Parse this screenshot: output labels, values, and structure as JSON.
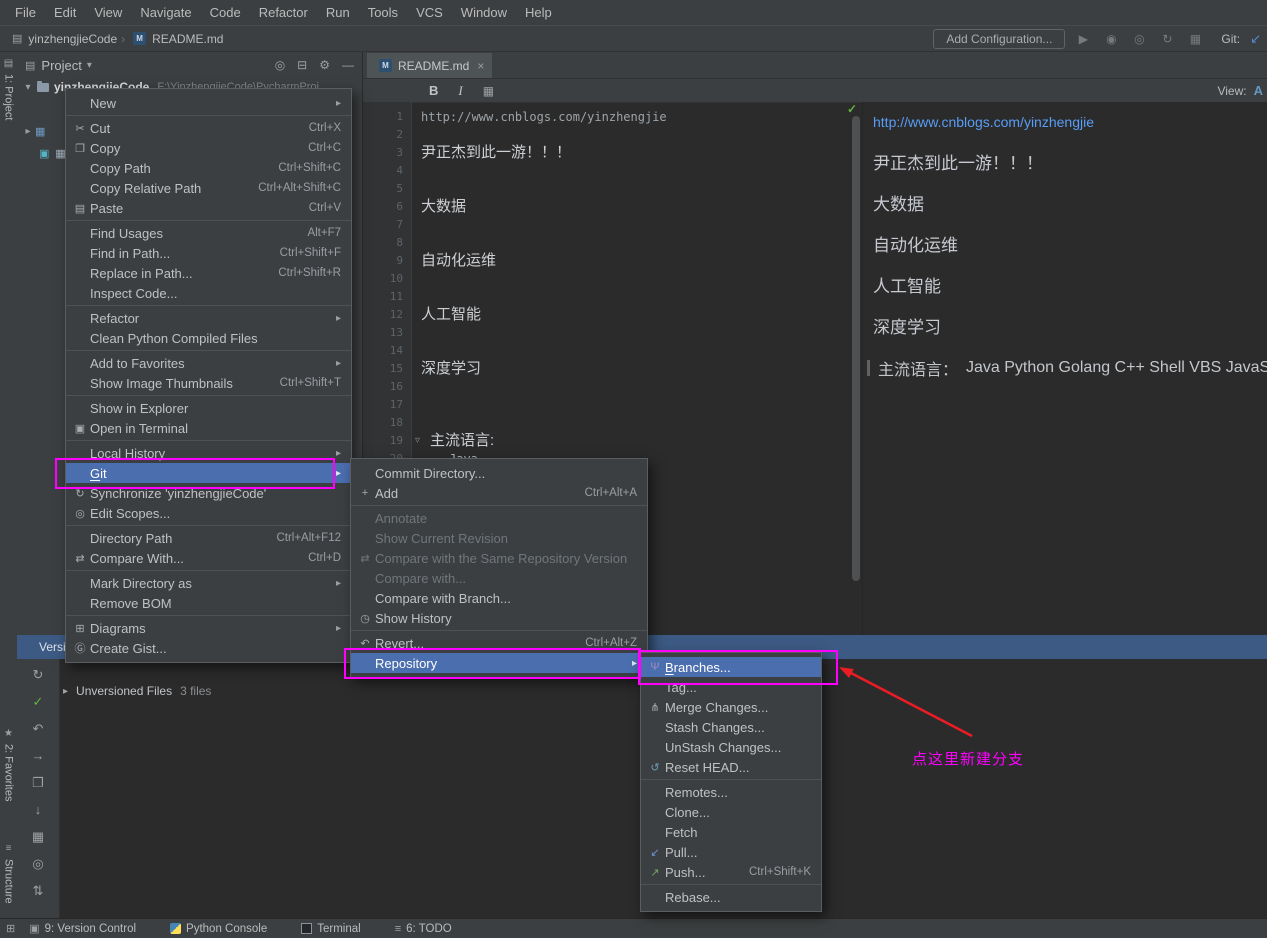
{
  "menubar": [
    "File",
    "Edit",
    "View",
    "Navigate",
    "Code",
    "Refactor",
    "Run",
    "Tools",
    "VCS",
    "Window",
    "Help"
  ],
  "navbar": {
    "project": "yinzhengjieCode",
    "file": "README.md",
    "add_configuration": "Add Configuration...",
    "actions": [
      "run",
      "debug",
      "coverage",
      "profiler",
      "stop"
    ],
    "git_label": "Git:"
  },
  "left_stripe": [
    {
      "label": "1: Project",
      "icon": "project"
    },
    {
      "label": "2: Favorites",
      "icon": "favorites"
    },
    {
      "label": "Structure",
      "icon": "structure"
    }
  ],
  "project_panel": {
    "title": "Project",
    "root_name": "yinzhengjieCode",
    "root_path": "F:\\YinzhengjieCode\\PycharmProj"
  },
  "editor": {
    "tab_title": "README.md",
    "toolbar": {
      "bold": "B",
      "italic": "I",
      "view_label": "View:",
      "view_mode": "A"
    },
    "lines": [
      {
        "n": "1",
        "text": "http://www.cnblogs.com/yinzhengjie",
        "style": "plain"
      },
      {
        "n": "2",
        "text": "",
        "style": "plain"
      },
      {
        "n": "3",
        "text": "尹正杰到此一游！！！",
        "style": "header"
      },
      {
        "n": "4",
        "text": "",
        "style": "plain"
      },
      {
        "n": "5",
        "text": "",
        "style": "plain"
      },
      {
        "n": "6",
        "text": "大数据",
        "style": "header"
      },
      {
        "n": "7",
        "text": "",
        "style": "plain"
      },
      {
        "n": "8",
        "text": "",
        "style": "plain"
      },
      {
        "n": "9",
        "text": "自动化运维",
        "style": "header"
      },
      {
        "n": "10",
        "text": "",
        "style": "plain"
      },
      {
        "n": "11",
        "text": "",
        "style": "plain"
      },
      {
        "n": "12",
        "text": "人工智能",
        "style": "header"
      },
      {
        "n": "13",
        "text": "",
        "style": "plain"
      },
      {
        "n": "14",
        "text": "",
        "style": "plain"
      },
      {
        "n": "15",
        "text": "深度学习",
        "style": "header"
      },
      {
        "n": "16",
        "text": "",
        "style": "plain"
      },
      {
        "n": "17",
        "text": "",
        "style": "plain"
      },
      {
        "n": "18",
        "text": "",
        "style": "plain"
      },
      {
        "n": "19",
        "text": "主流语言:",
        "style": "header",
        "fold": true
      },
      {
        "n": "20",
        "text": "Java",
        "style": "code",
        "indent": true
      }
    ]
  },
  "preview": {
    "link": "http://www.cnblogs.com/yinzhengjie",
    "headings": [
      "尹正杰到此一游！！！",
      "大数据",
      "自动化运维",
      "人工智能",
      "深度学习"
    ],
    "lang_line": {
      "label": "主流语言：",
      "value": "Java Python Golang C++ Shell VBS JavaS"
    }
  },
  "context_menu": {
    "items": [
      {
        "t": "New",
        "arrow": true
      },
      {
        "sep": true
      },
      {
        "t": "Cut",
        "s": "Ctrl+X",
        "i": "cut"
      },
      {
        "t": "Copy",
        "s": "Ctrl+C",
        "i": "copy"
      },
      {
        "t": "Copy Path",
        "s": "Ctrl+Shift+C"
      },
      {
        "t": "Copy Relative Path",
        "s": "Ctrl+Alt+Shift+C"
      },
      {
        "t": "Paste",
        "s": "Ctrl+V",
        "i": "paste"
      },
      {
        "sep": true
      },
      {
        "t": "Find Usages",
        "s": "Alt+F7"
      },
      {
        "t": "Find in Path...",
        "s": "Ctrl+Shift+F"
      },
      {
        "t": "Replace in Path...",
        "s": "Ctrl+Shift+R"
      },
      {
        "t": "Inspect Code..."
      },
      {
        "sep": true
      },
      {
        "t": "Ref<u></u>actor",
        "x": "Refactor",
        "arrow": true
      },
      {
        "t": "Clean Python Compiled Files"
      },
      {
        "sep": true
      },
      {
        "t": "Add to Favorites",
        "arrow": true
      },
      {
        "t": "Show Image Thumbnails",
        "s": "Ctrl+Shift+T"
      },
      {
        "sep": true
      },
      {
        "t": "Show in Explorer"
      },
      {
        "t": "Open in Terminal",
        "i": "terminal"
      },
      {
        "sep": true
      },
      {
        "t": "Local History",
        "arrow": true
      },
      {
        "t": "Git",
        "arrow": true,
        "sel": true,
        "m": "G"
      },
      {
        "t": "Synchronize 'yinzhengjieCode'",
        "i": "sync"
      },
      {
        "t": "Edit Scopes...",
        "i": "scope"
      },
      {
        "sep": true
      },
      {
        "t": "Directory Path",
        "s": "Ctrl+Alt+F12"
      },
      {
        "t": "Compare With...",
        "s": "Ctrl+D",
        "i": "compare"
      },
      {
        "sep": true
      },
      {
        "t": "Mark Directory as",
        "arrow": true
      },
      {
        "t": "Remove BOM"
      },
      {
        "sep": true
      },
      {
        "t": "Diagrams",
        "i": "diagram",
        "arrow": true
      },
      {
        "t": "Create Gist...",
        "i": "gist"
      }
    ]
  },
  "git_menu": {
    "items": [
      {
        "t": "Commit Directory..."
      },
      {
        "t": "Add",
        "s": "Ctrl+Alt+A",
        "i": "plus"
      },
      {
        "sep": true
      },
      {
        "t": "Annotate",
        "dis": true
      },
      {
        "t": "Show Current Revision",
        "dis": true
      },
      {
        "t": "Compare with the Same Repository Version",
        "dis": true,
        "i": "compare"
      },
      {
        "t": "Compare with...",
        "dis": true
      },
      {
        "t": "Compare with Branch..."
      },
      {
        "t": "Show History",
        "i": "clock"
      },
      {
        "sep": true
      },
      {
        "t": "Revert...",
        "s": "Ctrl+Alt+Z",
        "i": "revert"
      },
      {
        "t": "Repository",
        "arrow": true,
        "sel": true
      }
    ]
  },
  "repo_menu": {
    "items": [
      {
        "t": "Branches...",
        "sel": true,
        "i": "branch",
        "m": "B"
      },
      {
        "t": "Tag..."
      },
      {
        "t": "Merge Changes...",
        "i": "merge"
      },
      {
        "t": "Stash Changes..."
      },
      {
        "t": "UnStash Changes..."
      },
      {
        "t": "Reset HEAD...",
        "i": "reset"
      },
      {
        "sep": true
      },
      {
        "t": "Remotes..."
      },
      {
        "t": "Clone..."
      },
      {
        "t": "Fetch"
      },
      {
        "t": "Pull...",
        "i": "pull"
      },
      {
        "t": "Push...",
        "s": "Ctrl+Shift+K",
        "i": "push"
      },
      {
        "sep": true
      },
      {
        "t": "Rebase..."
      }
    ]
  },
  "annotation": {
    "label": "点这里新建分支"
  },
  "version_control": {
    "title": "Version Control",
    "toolbar": [
      "refresh",
      "commit",
      "rollback",
      "forward",
      "copy",
      "download",
      "group",
      "preview",
      "expand"
    ],
    "row_label": "Unversioned Files",
    "row_detail": "3 files"
  },
  "statusbar": {
    "items": [
      {
        "label": "9: Version Control",
        "icon": "vcs"
      },
      {
        "label": "Python Console",
        "icon": "python"
      },
      {
        "label": "Terminal",
        "icon": "terminal"
      },
      {
        "label": "6: TODO",
        "icon": "todo"
      }
    ]
  }
}
